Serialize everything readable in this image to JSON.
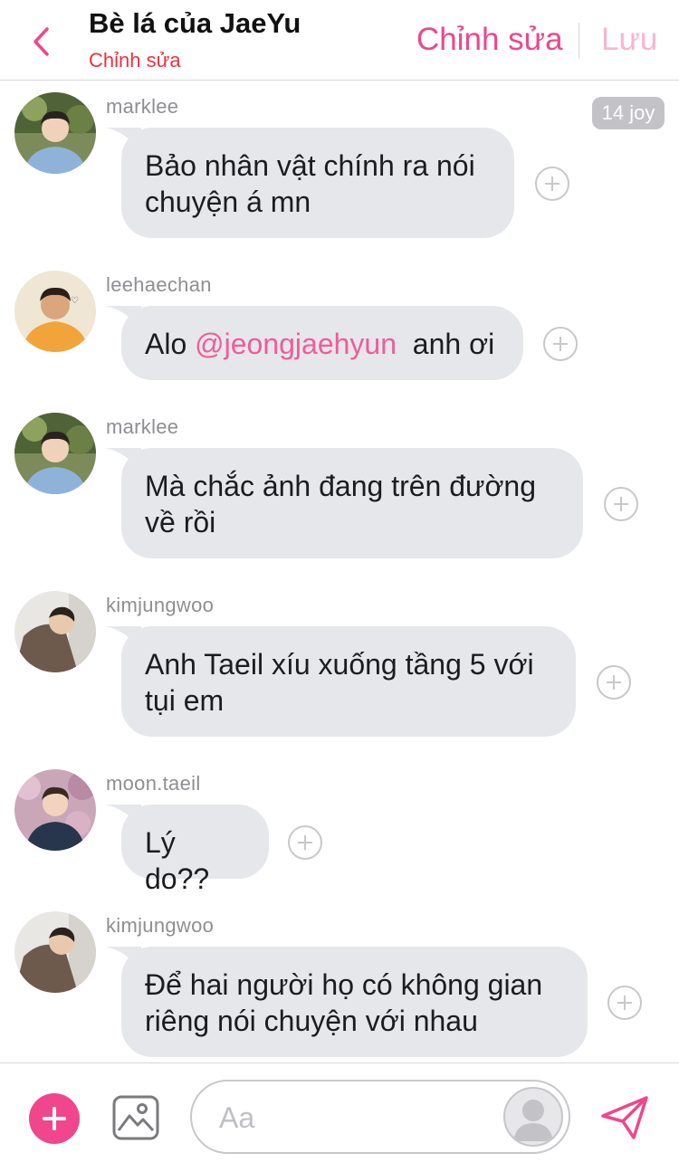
{
  "header": {
    "title": "Bè lá của JaeYu",
    "subtitle": "Chỉnh sửa",
    "edit_label": "Chỉnh sửa",
    "save_label": "Lưu"
  },
  "badge": "14 joy",
  "messages": [
    {
      "user": "marklee",
      "avatar": "avatar-marklee",
      "lines": [
        "Bảo nhân vật chính ra nói",
        "chuyện á mn"
      ]
    },
    {
      "user": "leehaechan",
      "avatar": "avatar-leehaechan",
      "before": "Alo ",
      "mention": "@jeongjaehyun",
      "after": "  anh ơi"
    },
    {
      "user": "marklee",
      "avatar": "avatar-marklee",
      "lines": [
        "Mà chắc ảnh đang trên đường",
        "về rồi"
      ]
    },
    {
      "user": "kimjungwoo",
      "avatar": "avatar-kimjungwoo",
      "lines": [
        "Anh Taeil xíu xuống tầng 5 với",
        "tụi em"
      ]
    },
    {
      "user": "moon.taeil",
      "avatar": "avatar-moontaeil",
      "lines": [
        "Lý do??"
      ]
    },
    {
      "user": "kimjungwoo",
      "avatar": "avatar-kimjungwoo",
      "lines": [
        "Để hai người họ có không gian",
        "riêng nói chuyện với nhau"
      ]
    }
  ],
  "composer": {
    "placeholder": "Aa"
  },
  "icons": {
    "back": "chevron-left-icon",
    "add": "plus-icon",
    "image": "image-icon",
    "send": "send-icon",
    "character": "person-icon",
    "reaction": "plus-circle-icon"
  },
  "colors": {
    "accent": "#f0468c",
    "accent_light": "#f7b6cf",
    "subtitle": "#f0303f",
    "bubble": "#e6e7ea",
    "mention": "#ee5d9a"
  }
}
